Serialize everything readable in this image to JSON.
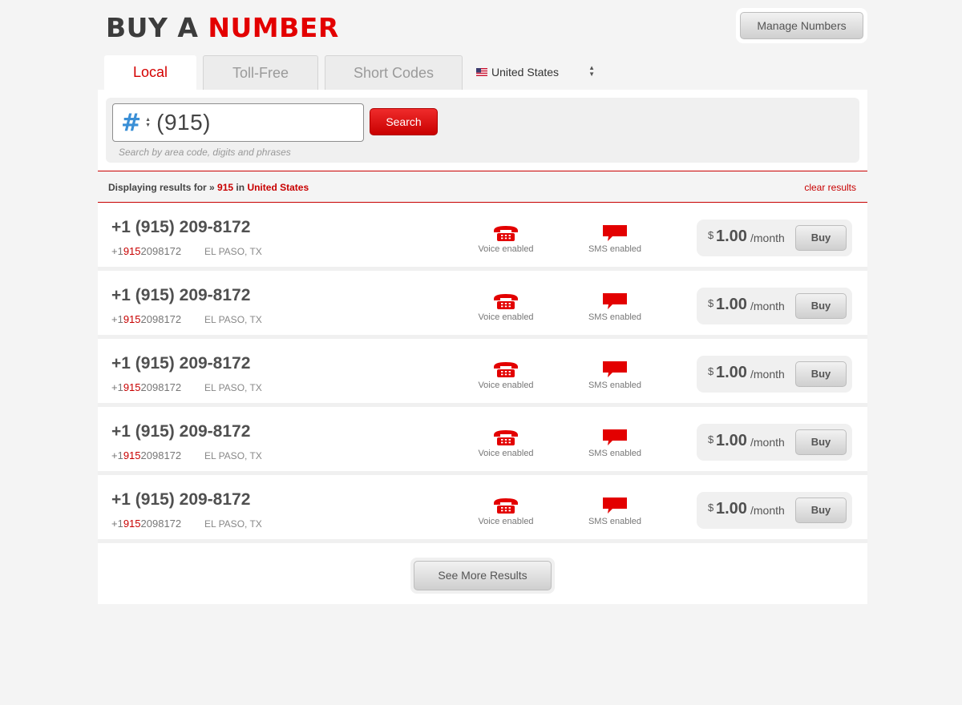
{
  "header": {
    "title_part1": "BUY A",
    "title_part2": "NUMBER",
    "manage_label": "Manage Numbers"
  },
  "tabs": [
    {
      "label": "Local",
      "active": true
    },
    {
      "label": "Toll-Free",
      "active": false
    },
    {
      "label": "Short Codes",
      "active": false
    }
  ],
  "country": {
    "selected": "United States",
    "flag": "us-flag-icon"
  },
  "search": {
    "prefix_symbol": "#",
    "value": "(915)",
    "button_label": "Search",
    "hint": "Search by area code, digits and phrases"
  },
  "results_bar": {
    "prefix": "Displaying results for »",
    "query": "915",
    "in_word": "in",
    "country": "United States",
    "clear_label": "clear results"
  },
  "results": [
    {
      "number": "+1 (915) 209-8172",
      "raw_prefix": "+1",
      "raw_match": "915",
      "raw_suffix": "2098172",
      "location": "EL PASO, TX",
      "voice_label": "Voice enabled",
      "sms_label": "SMS enabled",
      "currency": "$",
      "price": "1.00",
      "period": "/month",
      "buy_label": "Buy"
    },
    {
      "number": "+1 (915) 209-8172",
      "raw_prefix": "+1",
      "raw_match": "915",
      "raw_suffix": "2098172",
      "location": "EL PASO, TX",
      "voice_label": "Voice enabled",
      "sms_label": "SMS enabled",
      "currency": "$",
      "price": "1.00",
      "period": "/month",
      "buy_label": "Buy"
    },
    {
      "number": "+1 (915) 209-8172",
      "raw_prefix": "+1",
      "raw_match": "915",
      "raw_suffix": "2098172",
      "location": "EL PASO, TX",
      "voice_label": "Voice enabled",
      "sms_label": "SMS enabled",
      "currency": "$",
      "price": "1.00",
      "period": "/month",
      "buy_label": "Buy"
    },
    {
      "number": "+1 (915) 209-8172",
      "raw_prefix": "+1",
      "raw_match": "915",
      "raw_suffix": "2098172",
      "location": "EL PASO, TX",
      "voice_label": "Voice enabled",
      "sms_label": "SMS enabled",
      "currency": "$",
      "price": "1.00",
      "period": "/month",
      "buy_label": "Buy"
    },
    {
      "number": "+1 (915) 209-8172",
      "raw_prefix": "+1",
      "raw_match": "915",
      "raw_suffix": "2098172",
      "location": "EL PASO, TX",
      "voice_label": "Voice enabled",
      "sms_label": "SMS enabled",
      "currency": "$",
      "price": "1.00",
      "period": "/month",
      "buy_label": "Buy"
    }
  ],
  "see_more_label": "See More Results",
  "colors": {
    "accent": "#e30000",
    "link_blue": "#3a8fd6",
    "background": "#f4f4f4"
  },
  "icons": {
    "voice": "phone-icon",
    "sms": "speech-bubble-icon",
    "select": "up-down-arrows-icon"
  }
}
